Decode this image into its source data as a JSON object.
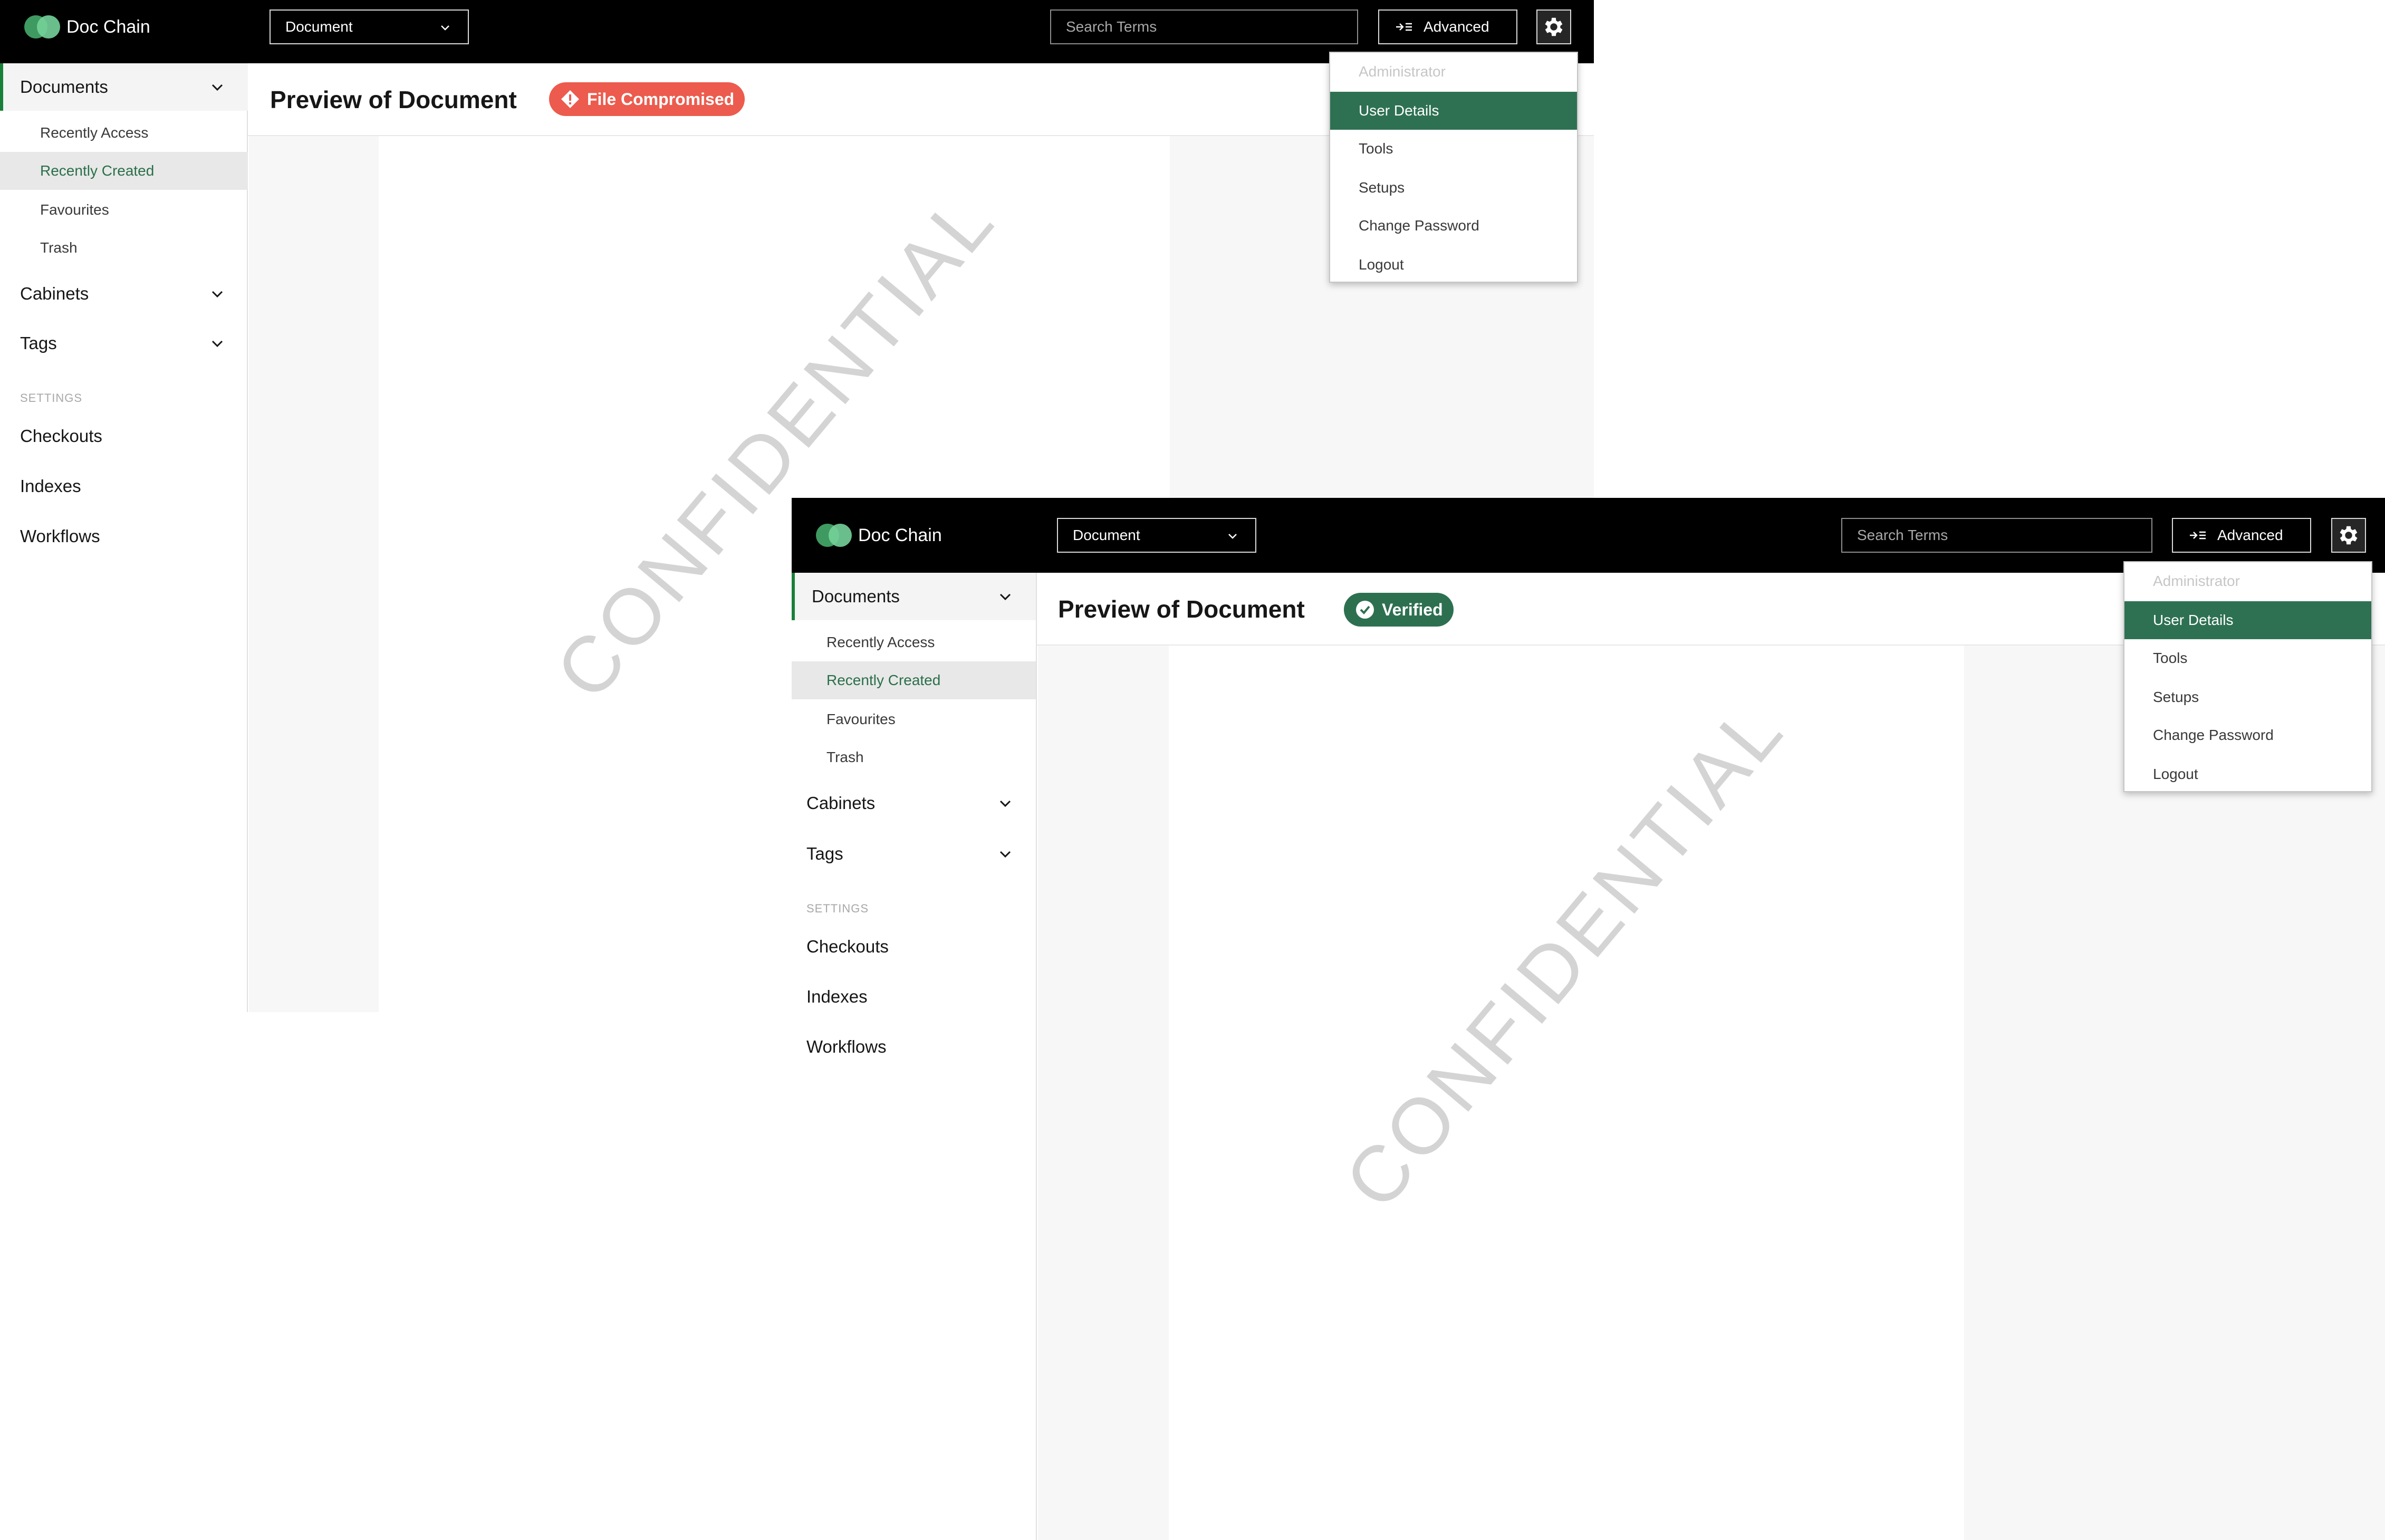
{
  "screens": [
    {
      "brand": "Doc Chain",
      "doc_select": "Document",
      "search_placeholder": "Search Terms",
      "advanced_label": "Advanced",
      "sidebar": {
        "documents": "Documents",
        "documents_items": [
          "Recently Access",
          "Recently Created",
          "Favourites",
          "Trash"
        ],
        "cabinets": "Cabinets",
        "tags": "Tags",
        "settings_heading": "SETTINGS",
        "links": [
          "Checkouts",
          "Indexes",
          "Workflows"
        ]
      },
      "page_title": "Preview of Document",
      "status_badge": "File Compromised",
      "watermark": "CONFIDENTIAL",
      "menu": [
        "Administrator",
        "User Details",
        "Tools",
        "Setups",
        "Change Password",
        "Logout"
      ]
    },
    {
      "brand": "Doc Chain",
      "doc_select": "Document",
      "search_placeholder": "Search Terms",
      "advanced_label": "Advanced",
      "sidebar": {
        "documents": "Documents",
        "documents_items": [
          "Recently Access",
          "Recently Created",
          "Favourites",
          "Trash"
        ],
        "cabinets": "Cabinets",
        "tags": "Tags",
        "settings_heading": "SETTINGS",
        "links": [
          "Checkouts",
          "Indexes",
          "Workflows"
        ]
      },
      "page_title": "Preview of Document",
      "status_badge": "Verified",
      "watermark": "CONFIDENTIAL",
      "menu": [
        "Administrator",
        "User Details",
        "Tools",
        "Setups",
        "Change Password",
        "Logout"
      ]
    }
  ],
  "colors": {
    "topbar": "#000000",
    "accent_green": "#2e7152",
    "danger_red": "#ec5b4d",
    "logo_green": "#3f9a61"
  },
  "icons": {
    "badge_compromised": "warning-diamond-icon",
    "badge_verified": "check-circle-icon",
    "advanced": "advanced-search-icon",
    "settings": "gear-icon"
  }
}
